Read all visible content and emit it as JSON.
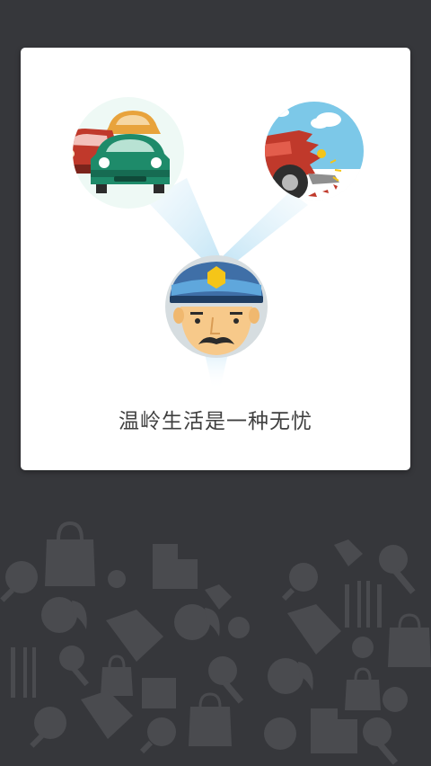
{
  "intro": {
    "caption": "温岭生活是一种无忧",
    "colors": {
      "background": "#36373b",
      "card": "#ffffff",
      "caption_text": "#404040",
      "pattern_icons": "#4a4b4f"
    },
    "icons": [
      "car-traffic-icon",
      "car-accident-icon",
      "traffic-police-icon"
    ]
  }
}
